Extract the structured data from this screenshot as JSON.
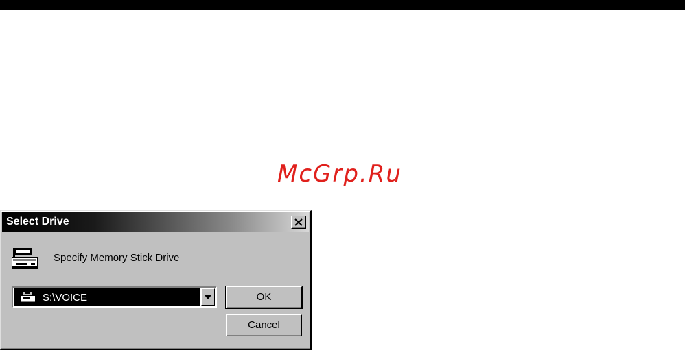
{
  "watermark": {
    "text": "McGrp.Ru",
    "color": "#e0201c"
  },
  "dialog": {
    "title": "Select Drive",
    "close_icon": "close-icon",
    "prompt": "Specify Memory Stick Drive",
    "prompt_icon": "memory-stick-drive-icon",
    "drive_select": {
      "selected_value": "S:\\VOICE",
      "item_icon": "drive-icon",
      "dropdown_icon": "chevron-down-icon"
    },
    "ok_label": "OK",
    "cancel_label": "Cancel"
  },
  "colors": {
    "dialog_face": "#c0c0c0",
    "title_bar_start": "#000000",
    "title_bar_end": "#d8d8d8",
    "selection_bg": "#000000",
    "top_strip": "#000000"
  }
}
